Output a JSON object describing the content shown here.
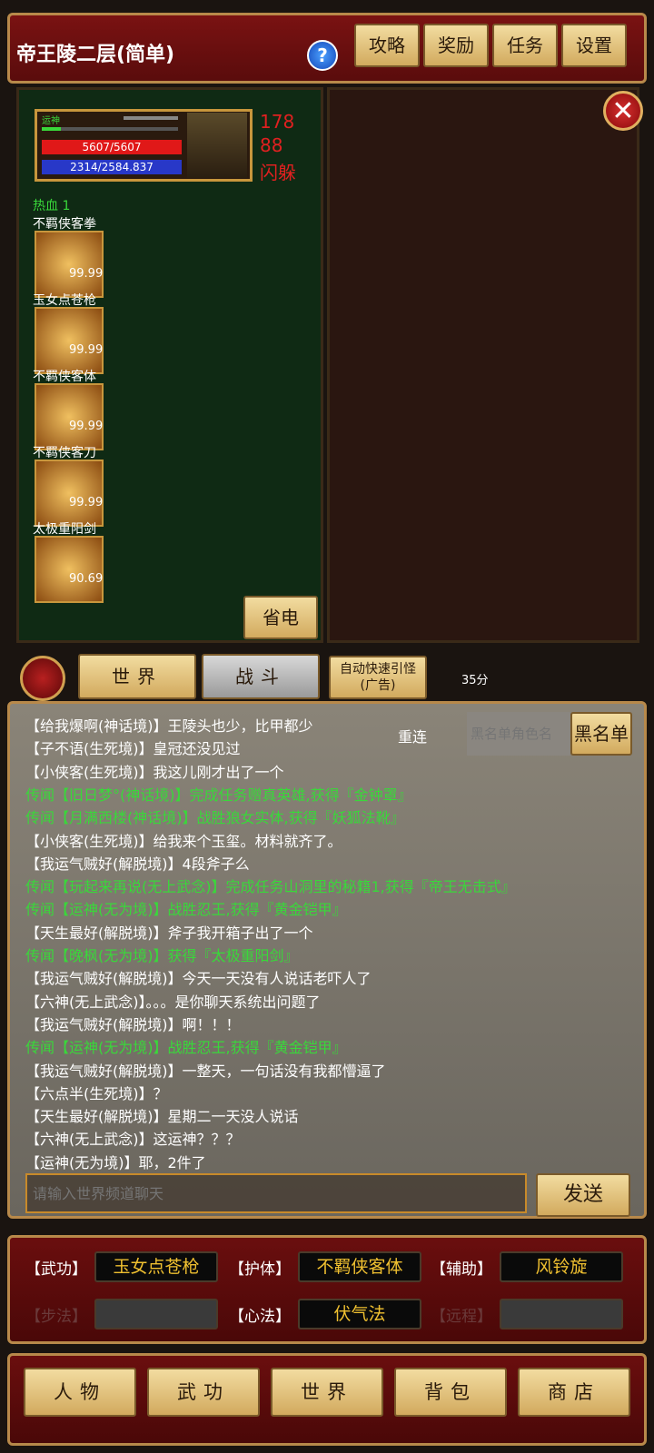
{
  "header": {
    "title": "帝王陵二层(简单)",
    "help": "?",
    "buttons": [
      "攻略",
      "奖励",
      "任务",
      "设置"
    ]
  },
  "close": "✕",
  "player": {
    "name": "运神",
    "hp": "5607/5607",
    "mp": "2314/2584.837",
    "stat1": "178",
    "stat2": "88",
    "stat3": "闪躲"
  },
  "buff": "热血 1",
  "skills": [
    {
      "name": "不羁侠客拳",
      "value": "99.99"
    },
    {
      "name": "玉女点苍枪",
      "value": "99.99"
    },
    {
      "name": "不羁侠客体",
      "value": "99.99"
    },
    {
      "name": "不羁侠客刀",
      "value": "99.99"
    },
    {
      "name": "太极重阳剑",
      "value": "90.69"
    }
  ],
  "power_save": "省电",
  "tabs": {
    "world": "世界",
    "battle": "战斗",
    "auto": "自动快速引怪",
    "ad": "(广告)",
    "timer": "35分"
  },
  "chat": {
    "reconnect": "重连",
    "blacklist_placeholder": "黑名单角色名",
    "blacklist_button": "黑名单",
    "messages": [
      {
        "text": "【给我爆啊(神话境)】王陵头也少，比甲都少",
        "system": false
      },
      {
        "text": "【子不语(生死境)】皇冠还没见过",
        "system": false
      },
      {
        "text": "【小侠客(生死境)】我这儿刚才出了一个",
        "system": false
      },
      {
        "text": "传闻【旧日梦°(神话境)】完成任务赠真英雄,获得『金钟罩』",
        "system": true
      },
      {
        "text": "传闻【月满西楼(神话境)】战胜狼女实体,获得『妖狐法靴』",
        "system": true
      },
      {
        "text": "【小侠客(生死境)】给我来个玉玺。材料就齐了。",
        "system": false
      },
      {
        "text": "【我运气贼好(解脱境)】4段斧子么",
        "system": false
      },
      {
        "text": "传闻【玩起来再说(无上武念)】完成任务山洞里的秘籍1,获得『帝王无击式』",
        "system": true
      },
      {
        "text": "传闻【运神(无为境)】战胜忍王,获得『黄金铠甲』",
        "system": true
      },
      {
        "text": "【天生最好(解脱境)】斧子我开箱子出了一个",
        "system": false
      },
      {
        "text": "传闻【晚枫(无为境)】获得『太极重阳剑』",
        "system": true
      },
      {
        "text": "【我运气贼好(解脱境)】今天一天没有人说话老吓人了",
        "system": false
      },
      {
        "text": "【六神(无上武念)】。。。是你聊天系统出问题了",
        "system": false
      },
      {
        "text": "【我运气贼好(解脱境)】啊！！！",
        "system": false
      },
      {
        "text": "传闻【运神(无为境)】战胜忍王,获得『黄金铠甲』",
        "system": true
      },
      {
        "text": "【我运气贼好(解脱境)】一整天，一句话没有我都懵逼了",
        "system": false
      },
      {
        "text": "【六点半(生死境)】？",
        "system": false
      },
      {
        "text": "【天生最好(解脱境)】星期二一天没人说话",
        "system": false
      },
      {
        "text": "【六神(无上武念)】这运神？？？",
        "system": false
      },
      {
        "text": "【运神(无为境)】耶，2件了",
        "system": false
      }
    ],
    "input_placeholder": "请输入世界频道聊天",
    "send": "发送"
  },
  "equip": {
    "wugong_label": "【武功】",
    "wugong": "玉女点苍枪",
    "huti_label": "【护体】",
    "huti": "不羁侠客体",
    "fuzhu_label": "【辅助】",
    "fuzhu": "风铃旋",
    "bufa_label": "【步法】",
    "bufa": "",
    "xinfa_label": "【心法】",
    "xinfa": "伏气法",
    "yuancheng_label": "【远程】",
    "yuancheng": ""
  },
  "nav": [
    "人物",
    "武功",
    "世界",
    "背包",
    "商店"
  ]
}
